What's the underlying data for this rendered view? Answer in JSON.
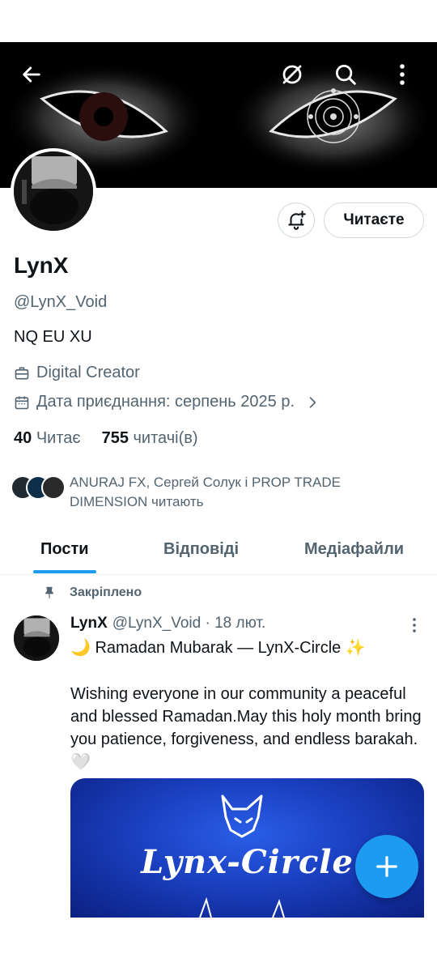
{
  "banner": {
    "back_icon": "arrow-left-icon",
    "unmute_icon": "slash-circle-icon",
    "search_icon": "search-icon",
    "more_icon": "more-vertical-icon"
  },
  "actions": {
    "notify_icon": "bell-plus-icon",
    "follow_label": "Читаєте"
  },
  "profile": {
    "name": "LynX",
    "handle": "@LynX_Void",
    "bio": "NQ EU XU",
    "category": "Digital Creator",
    "joined": "Дата приєднання: серпень 2025 р.",
    "following_count": "40",
    "following_label": "Читає",
    "followers_count": "755",
    "followers_label": "читачі(в)",
    "followed_by": "ANURAJ FX, Сергей Солук і PROP TRADE DIMENSION читають"
  },
  "tabs": [
    {
      "label": "Пости"
    },
    {
      "label": "Відповіді"
    },
    {
      "label": "Медіафайли"
    }
  ],
  "post": {
    "pinned_label": "Закріплено",
    "author": "LynX",
    "meta": "@LynX_Void · 18 лют.",
    "line1": "🌙 Ramadan Mubarak — LynX-Circle ✨",
    "body": "Wishing everyone in our community a peaceful and blessed Ramadan.May this holy month bring you patience, forgiveness, and endless barakah. 🤍",
    "media_title": "Lynx-Circle"
  },
  "fab_icon": "plus-icon",
  "colors": {
    "accent": "#1d9bf0",
    "secondary_text": "#536471",
    "border": "#cfd9de"
  }
}
